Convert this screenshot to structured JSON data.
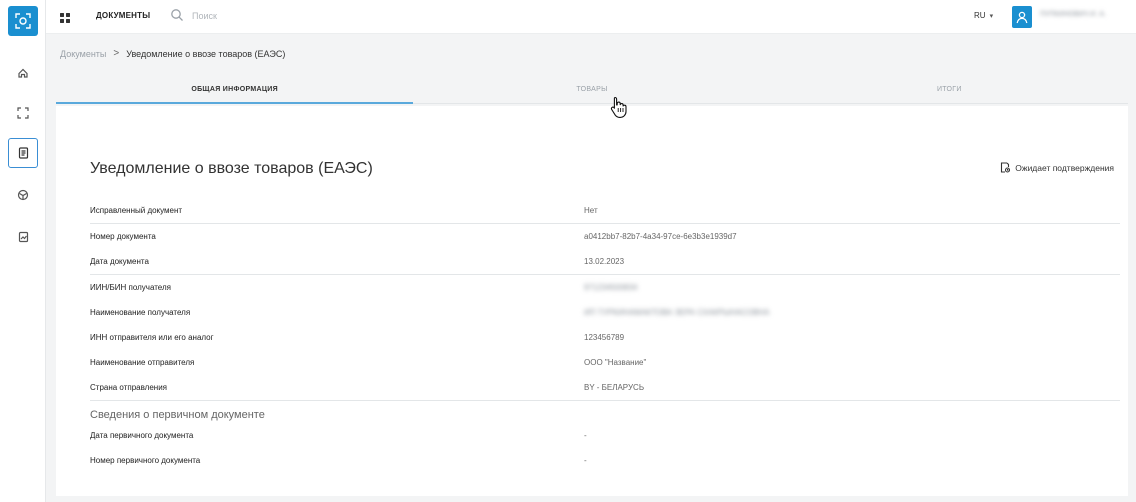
{
  "nav": {
    "docs_label": "ДОКУМЕНТЫ"
  },
  "search": {
    "placeholder": "Поиск",
    "value": ""
  },
  "lang": {
    "label": "RU",
    "chevron": "▾"
  },
  "user": {
    "name": "ПУПКИНОВИЧ И. А."
  },
  "breadcrumb": {
    "root": "Документы",
    "separator": ">",
    "current": "Уведомление о ввозе товаров (ЕАЭС)"
  },
  "tabs": [
    {
      "label": "ОБЩАЯ ИНФОРМАЦИЯ"
    },
    {
      "label": "ТОВАРЫ"
    },
    {
      "label": "ИТОГИ"
    }
  ],
  "document": {
    "title": "Уведомление о ввозе товаров (ЕАЭС)",
    "status": "Ожидает подтверждения",
    "rows": [
      {
        "label": "Исправленный документ",
        "value": "Нет"
      },
      {
        "label": "Номер документа",
        "value": "a0412bb7-82b7-4a34-97ce-6e3b3e1939d7"
      },
      {
        "label": "Дата документа",
        "value": "13.02.2023"
      },
      {
        "label": "ИИН/БИН получателя",
        "value": "971234500834"
      },
      {
        "label": "Наименование получателя",
        "value": "ИП ТУРКИНАМАКТОВА ЗЕРА СХАКРЫНАСОВНА"
      },
      {
        "label": "ИНН отправителя или его аналог",
        "value": "123456789"
      },
      {
        "label": "Наименование отправителя",
        "value": "ООО \"Название\""
      },
      {
        "label": "Страна отправления",
        "value": "BY - БЕЛАРУСЬ"
      }
    ],
    "primary_section": {
      "title": "Сведения о первичном документе",
      "rows": [
        {
          "label": "Дата первичного документа",
          "value": "-"
        },
        {
          "label": "Номер первичного документа",
          "value": "-"
        }
      ]
    }
  },
  "colors": {
    "accent": "#1a8fd0",
    "tab_underline": "#5aa9dc"
  },
  "icons": {
    "logo": "scan-logo-icon",
    "sidebar": [
      "home-icon",
      "scan-frame-icon",
      "document-icon",
      "box-icon",
      "chart-icon"
    ],
    "topbar": [
      "apps-grid-icon",
      "search-icon",
      "user-icon"
    ],
    "status": "pending-document-icon"
  }
}
